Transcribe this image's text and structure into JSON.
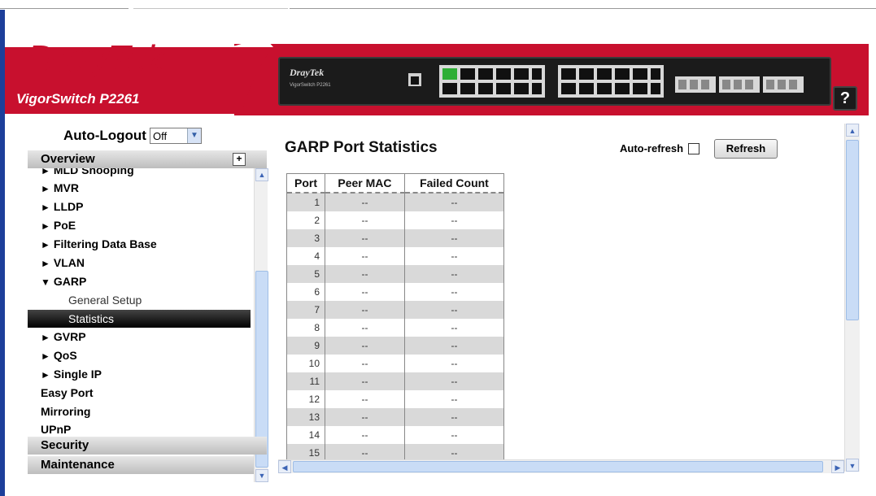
{
  "header": {
    "logo_part1": "Dray",
    "logo_part2": "Tek",
    "product_name": "VigorSwitch P2261",
    "panel_logo": "DrayTek",
    "panel_model": "VigorSwitch P2261",
    "help_label": "?"
  },
  "sidebar": {
    "autologout_label": "Auto-Logout",
    "autologout_value": "Off",
    "overview_label": "Overview",
    "nav": [
      {
        "label": "MLD Snooping",
        "type": "group"
      },
      {
        "label": "MVR",
        "type": "group"
      },
      {
        "label": "LLDP",
        "type": "group"
      },
      {
        "label": "PoE",
        "type": "group"
      },
      {
        "label": "Filtering Data Base",
        "type": "group"
      },
      {
        "label": "VLAN",
        "type": "group"
      },
      {
        "label": "GARP",
        "type": "group-open"
      },
      {
        "label": "General Setup",
        "type": "sub"
      },
      {
        "label": "Statistics",
        "type": "sub-selected"
      },
      {
        "label": "GVRP",
        "type": "group"
      },
      {
        "label": "QoS",
        "type": "group"
      },
      {
        "label": "Single IP",
        "type": "group"
      },
      {
        "label": "Easy Port",
        "type": "plain"
      },
      {
        "label": "Mirroring",
        "type": "plain"
      },
      {
        "label": "UPnP",
        "type": "plain"
      }
    ],
    "security_label": "Security",
    "maintenance_label": "Maintenance"
  },
  "main": {
    "title": "GARP Port Statistics",
    "autorefresh_label": "Auto-refresh",
    "refresh_label": "Refresh",
    "table": {
      "headers": [
        "Port",
        "Peer MAC",
        "Failed Count"
      ],
      "rows": [
        [
          "1",
          "--",
          "--"
        ],
        [
          "2",
          "--",
          "--"
        ],
        [
          "3",
          "--",
          "--"
        ],
        [
          "4",
          "--",
          "--"
        ],
        [
          "5",
          "--",
          "--"
        ],
        [
          "6",
          "--",
          "--"
        ],
        [
          "7",
          "--",
          "--"
        ],
        [
          "8",
          "--",
          "--"
        ],
        [
          "9",
          "--",
          "--"
        ],
        [
          "10",
          "--",
          "--"
        ],
        [
          "11",
          "--",
          "--"
        ],
        [
          "12",
          "--",
          "--"
        ],
        [
          "13",
          "--",
          "--"
        ],
        [
          "14",
          "--",
          "--"
        ],
        [
          "15",
          "--",
          "--"
        ]
      ]
    }
  },
  "colors": {
    "brand_red": "#c8102e",
    "frame_blue": "#1d3f9a"
  }
}
